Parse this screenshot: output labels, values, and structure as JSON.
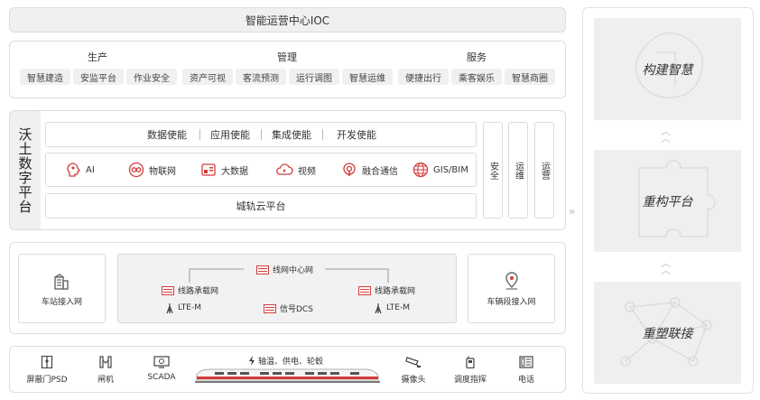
{
  "ioc": {
    "title": "智能运营中心IOC"
  },
  "business": {
    "groups": [
      {
        "title": "生产",
        "items": [
          "智慧建造",
          "安监平台",
          "作业安全"
        ]
      },
      {
        "title": "管理",
        "items": [
          "资产可视",
          "客流预测",
          "运行调图",
          "智慧运维"
        ]
      },
      {
        "title": "服务",
        "items": [
          "便捷出行",
          "乘客娱乐",
          "智慧商圈"
        ]
      }
    ]
  },
  "platform": {
    "label": "沃土数字平台",
    "enable": [
      "数据使能",
      "应用使能",
      "集成使能",
      "开发使能"
    ],
    "tech": [
      "AI",
      "物联网",
      "大数据",
      "视频",
      "融合通信",
      "GIS/BIM"
    ],
    "cloud": "城轨云平台",
    "side": [
      "安全",
      "运维",
      "运营"
    ]
  },
  "network": {
    "station": "车站接入网",
    "center": "线网中心网",
    "line_left": "线路承载网",
    "line_right": "线路承载网",
    "ltem_left": "LTE-M",
    "signal": "信号DCS",
    "ltem_right": "LTE-M",
    "vehicle": "车辆段接入网"
  },
  "devices": {
    "items": [
      "屏蔽门PSD",
      "闸机",
      "SCADA",
      "摄像头",
      "调度指挥",
      "电话"
    ],
    "train_caption": "轴温、供电、轮毂"
  },
  "right": {
    "steps": [
      "构建智慧",
      "重构平台",
      "重塑联接"
    ]
  },
  "colors": {
    "accent": "#d23c3c",
    "panel": "#f0f0f0",
    "border": "#dcdcdc"
  }
}
